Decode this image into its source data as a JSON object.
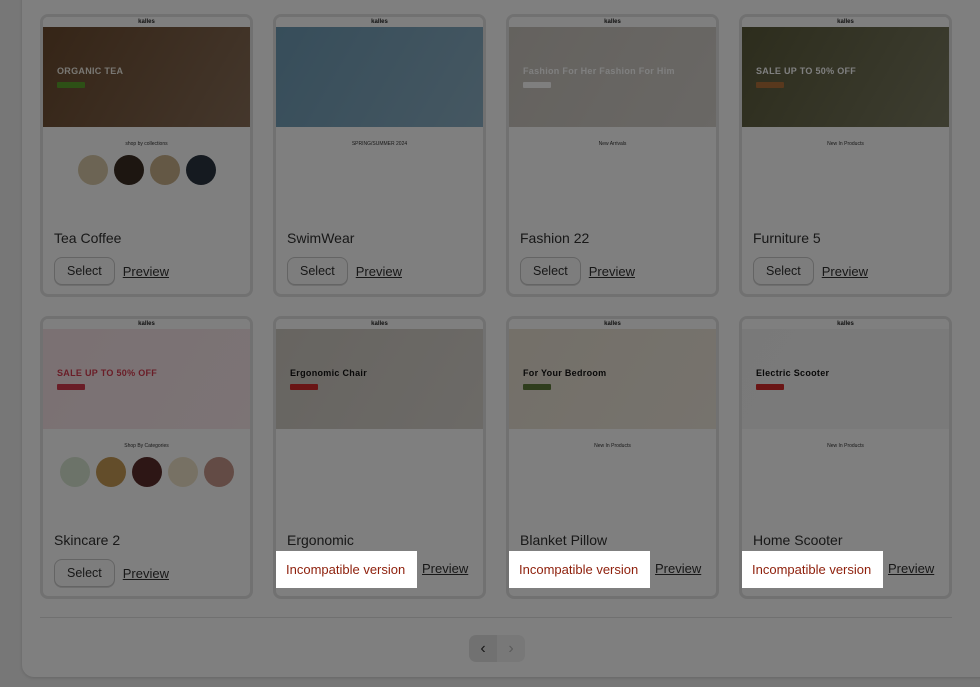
{
  "themes": [
    {
      "name": "Tea Coffee",
      "action": "Select",
      "preview": "Preview",
      "hero_text": "ORGANIC TEA",
      "section": "shop by collections",
      "hero_color": "#6b4a2e",
      "text_color": "#f2efe6",
      "btn_color": "#5aa02c",
      "circle_colors": [
        "#d8c9a8",
        "#3a2c22",
        "#c9b08a",
        "#2a3440"
      ]
    },
    {
      "name": "SwimWear",
      "action": "Select",
      "preview": "Preview",
      "hero_text": "",
      "section": "SPRING/SUMMER 2024",
      "hero_color": "#6e9bb5",
      "text_color": "#fff",
      "btn_color": "",
      "circle_colors": []
    },
    {
      "name": "Fashion 22",
      "action": "Select",
      "preview": "Preview",
      "hero_text": "Fashion For Her   Fashion For Him",
      "section": "New Arrivals",
      "hero_color": "#c9c4bd",
      "text_color": "#fff",
      "btn_color": "#fff",
      "circle_colors": []
    },
    {
      "name": "Furniture 5",
      "action": "Select",
      "preview": "Preview",
      "hero_text": "SALE UP TO 50% OFF",
      "section": "New In Products",
      "hero_color": "#5a5a3a",
      "text_color": "#fff",
      "btn_color": "#b0703a",
      "circle_colors": []
    },
    {
      "name": "Skincare 2",
      "action": "Select",
      "preview": "Preview",
      "hero_text": "SALE UP TO 50% OFF",
      "section": "Shop By Categories",
      "hero_color": "#f6e2e6",
      "text_color": "#d43a4e",
      "btn_color": "#d43a4e",
      "circle_colors": [
        "#d9e6d2",
        "#c79a55",
        "#5a2d2a",
        "#efe3c8",
        "#c7968a"
      ]
    },
    {
      "name": "Ergonomic",
      "action": "Incompatible version",
      "preview": "Preview",
      "hero_text": "Ergonomic Chair",
      "section": "",
      "hero_color": "#cfcac2",
      "text_color": "#111",
      "btn_color": "#d42a2a",
      "circle_colors": []
    },
    {
      "name": "Blanket Pillow",
      "action": "Incompatible version",
      "preview": "Preview",
      "hero_text": "For Your Bedroom",
      "section": "New In Products",
      "hero_color": "#e8e0d2",
      "text_color": "#111",
      "btn_color": "#5f7a3a",
      "circle_colors": []
    },
    {
      "name": "Home Scooter",
      "action": "Incompatible version",
      "preview": "Preview",
      "hero_text": "Electric Scooter",
      "section": "New In Products",
      "hero_color": "#f3f3f3",
      "text_color": "#111",
      "btn_color": "#d42a2a",
      "circle_colors": []
    }
  ],
  "brand": "kalles",
  "pagination": {
    "prev": "‹",
    "next": "›"
  },
  "colors": {
    "incompatible": "#8e1f0b"
  }
}
